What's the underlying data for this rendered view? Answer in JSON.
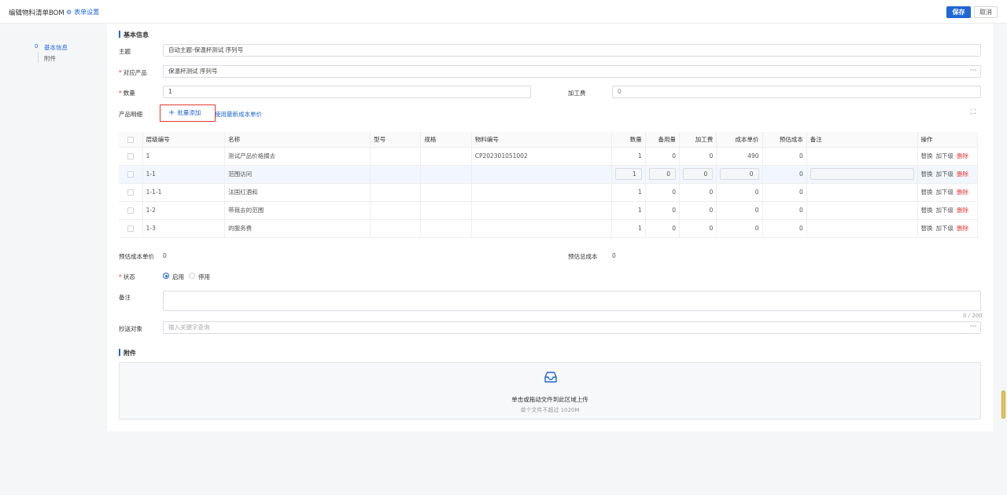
{
  "header": {
    "title": "编辑物料清单BOM",
    "form_settings": "表单设置",
    "save": "保存",
    "cancel": "取消"
  },
  "nav": {
    "items": [
      "基本信息",
      "附件"
    ],
    "marker": "0"
  },
  "basic": {
    "section_title": "基本信息",
    "subject_label": "主题",
    "subject_value": "自动主题-保温杯测试 序列号",
    "product_label": "对应产品",
    "product_value": "保温杯测试 序列号",
    "qty_label": "数量",
    "qty_value": "1",
    "fee_label": "加工费",
    "fee_value": "0",
    "detail_label": "产品明细",
    "batch_add": "批量添加",
    "use_latest": "使用最新成本单价"
  },
  "table": {
    "headers": [
      "层级编号",
      "名称",
      "型号",
      "规格",
      "物料编号",
      "数量",
      "备用量",
      "加工费",
      "成本单价",
      "预估成本",
      "备注",
      "操作"
    ],
    "rows": [
      {
        "level": "1",
        "name": "测试产品价格摘去",
        "model": "",
        "spec": "",
        "code": "CP202301051002",
        "qty": "1",
        "spare": "0",
        "fee": "0",
        "unit": "490",
        "est": "0",
        "note": ""
      },
      {
        "level": "1-1",
        "name": "范围访问",
        "model": "",
        "spec": "",
        "code": "",
        "qty": "1",
        "spare": "0",
        "fee": "0",
        "unit": "0",
        "est": "0",
        "note": ""
      },
      {
        "level": "1-1-1",
        "name": "法国红酒和",
        "model": "",
        "spec": "",
        "code": "",
        "qty": "1",
        "spare": "0",
        "fee": "0",
        "unit": "0",
        "est": "0",
        "note": ""
      },
      {
        "level": "1-2",
        "name": "带我去的范围",
        "model": "",
        "spec": "",
        "code": "",
        "qty": "1",
        "spare": "0",
        "fee": "0",
        "unit": "0",
        "est": "0",
        "note": ""
      },
      {
        "level": "1-3",
        "name": "的服务费",
        "model": "",
        "spec": "",
        "code": "",
        "qty": "1",
        "spare": "0",
        "fee": "0",
        "unit": "0",
        "est": "0",
        "note": ""
      }
    ],
    "actions": {
      "replace": "替换",
      "add_sub": "加下级",
      "delete": "删除"
    }
  },
  "summary": {
    "unit_cost_label": "预估成本单价",
    "unit_cost_value": "0",
    "total_cost_label": "预估总成本",
    "total_cost_value": "0"
  },
  "status": {
    "label": "状态",
    "enabled": "启用",
    "disabled": "停用",
    "selected": "启用"
  },
  "remark": {
    "label": "备注",
    "counter": "0 / 200"
  },
  "cc": {
    "label": "抄送对象",
    "placeholder": "输入关键字查询"
  },
  "attachment": {
    "section_title": "附件",
    "upload_text": "单击或拖动文件到此区域上传",
    "upload_hint": "单个文件不超过 1020M"
  },
  "colors": {
    "primary": "#1f66d6",
    "danger": "#e53935"
  }
}
